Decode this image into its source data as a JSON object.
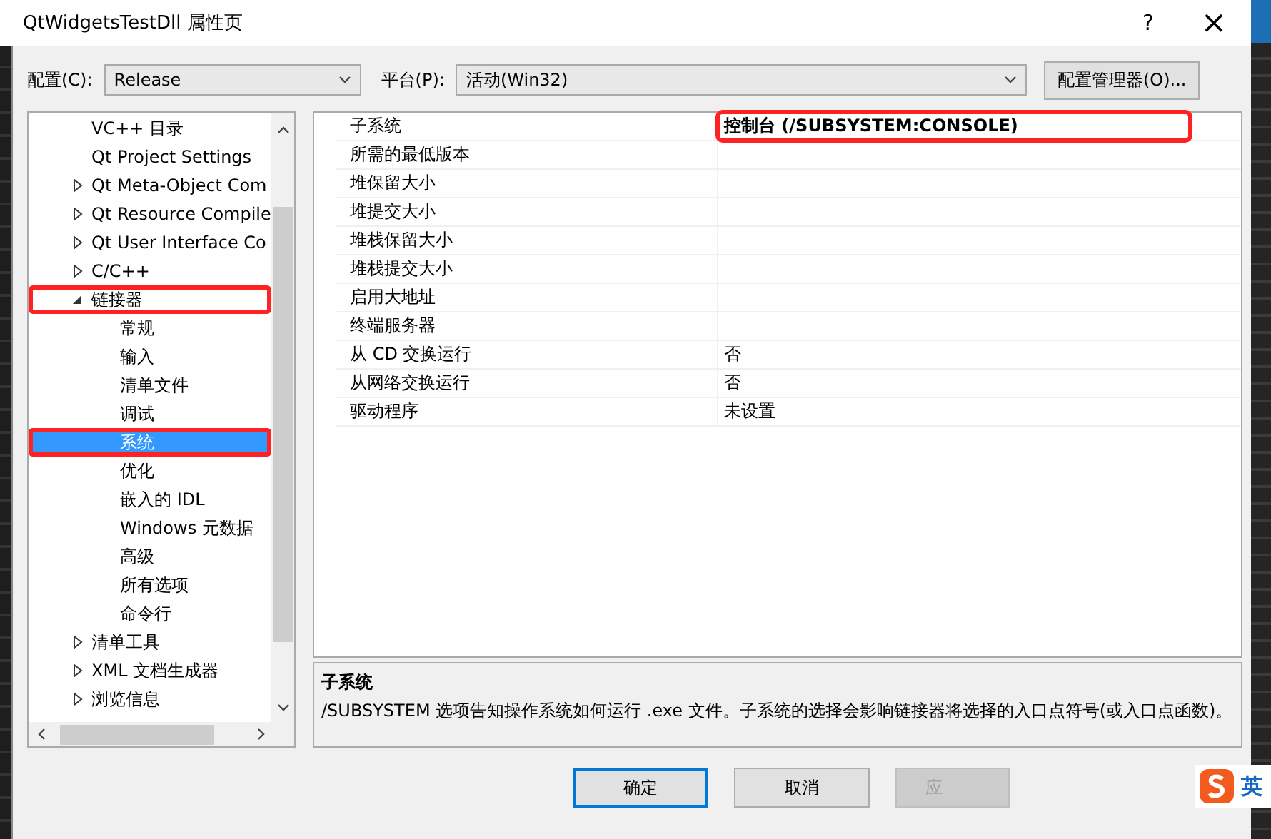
{
  "window": {
    "title": "QtWidgetsTestDll 属性页",
    "help": "?",
    "close": "×"
  },
  "config": {
    "label": "配置(C):",
    "value": "Release"
  },
  "platform": {
    "label": "平台(P):",
    "value": "活动(Win32)"
  },
  "config_manager_button": "配置管理器(O)...",
  "tree": [
    {
      "label": "VC++ 目录",
      "selected": false,
      "highlighted": false
    },
    {
      "label": "Qt Project Settings",
      "selected": false,
      "highlighted": false
    },
    {
      "label": "Qt Meta-Object Com",
      "expanded": false,
      "selected": false,
      "highlighted": false
    },
    {
      "label": "Qt Resource Compile",
      "expanded": false,
      "selected": false,
      "highlighted": false
    },
    {
      "label": "Qt User Interface Co",
      "expanded": false,
      "selected": false,
      "highlighted": false
    },
    {
      "label": "C/C++",
      "expanded": false,
      "selected": false,
      "highlighted": false
    },
    {
      "label": "链接器",
      "expanded": true,
      "selected": false,
      "highlighted": true,
      "children": [
        {
          "label": "常规",
          "selected": false,
          "highlighted": false
        },
        {
          "label": "输入",
          "selected": false,
          "highlighted": false
        },
        {
          "label": "清单文件",
          "selected": false,
          "highlighted": false
        },
        {
          "label": "调试",
          "selected": false,
          "highlighted": false
        },
        {
          "label": "系统",
          "selected": true,
          "highlighted": true
        },
        {
          "label": "优化",
          "selected": false,
          "highlighted": false
        },
        {
          "label": "嵌入的 IDL",
          "selected": false,
          "highlighted": false
        },
        {
          "label": "Windows 元数据",
          "selected": false,
          "highlighted": false
        },
        {
          "label": "高级",
          "selected": false,
          "highlighted": false
        },
        {
          "label": "所有选项",
          "selected": false,
          "highlighted": false
        },
        {
          "label": "命令行",
          "selected": false,
          "highlighted": false
        }
      ]
    },
    {
      "label": "清单工具",
      "expanded": false,
      "selected": false,
      "highlighted": false
    },
    {
      "label": "XML 文档生成器",
      "expanded": false,
      "selected": false,
      "highlighted": false
    },
    {
      "label": "浏览信息",
      "expanded": false,
      "selected": false,
      "highlighted": false
    }
  ],
  "properties": [
    {
      "name": "子系统",
      "value": "控制台 (/SUBSYSTEM:CONSOLE)",
      "bold": true,
      "highlighted": true
    },
    {
      "name": "所需的最低版本"
    },
    {
      "name": "堆保留大小"
    },
    {
      "name": "堆提交大小"
    },
    {
      "name": "堆栈保留大小"
    },
    {
      "name": "堆栈提交大小"
    },
    {
      "name": "启用大地址"
    },
    {
      "name": "终端服务器"
    },
    {
      "name": "从 CD 交换运行",
      "value": "否",
      "bold": false,
      "highlighted": false
    },
    {
      "name": "从网络交换运行",
      "value": "否",
      "bold": false,
      "highlighted": false
    },
    {
      "name": "驱动程序",
      "value": "未设置",
      "bold": false,
      "highlighted": false
    }
  ],
  "description": {
    "title": "子系统",
    "text": "/SUBSYSTEM 选项告知操作系统如何运行 .exe 文件。子系统的选择会影响链接器将选择的入口点符号(或入口点函数)。"
  },
  "buttons": [
    {
      "label": "确定",
      "default": true,
      "disabled": false
    },
    {
      "label": "取消",
      "default": false,
      "disabled": false
    },
    {
      "label": "应",
      "default": false,
      "disabled": true
    }
  ],
  "ime": {
    "label": "英"
  }
}
